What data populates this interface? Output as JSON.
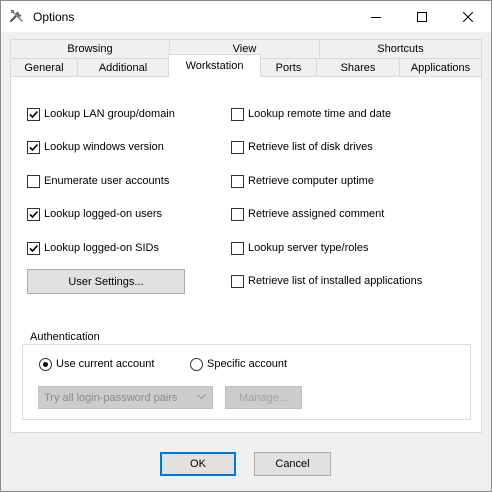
{
  "window": {
    "title": "Options"
  },
  "tabs": {
    "row1": [
      "Browsing",
      "View",
      "Shortcuts"
    ],
    "row2": [
      "General",
      "Additional",
      "Workstation",
      "Ports",
      "Shares",
      "Applications"
    ],
    "active": "Workstation"
  },
  "options_left": [
    {
      "label": "Lookup LAN group/domain",
      "checked": true
    },
    {
      "label": "Lookup windows version",
      "checked": true
    },
    {
      "label": "Enumerate user accounts",
      "checked": false
    },
    {
      "label": "Lookup logged-on users",
      "checked": true
    },
    {
      "label": "Lookup logged-on SIDs",
      "checked": true
    }
  ],
  "options_right": [
    {
      "label": "Lookup remote time and date",
      "checked": false
    },
    {
      "label": "Retrieve list of disk drives",
      "checked": false
    },
    {
      "label": "Retrieve computer uptime",
      "checked": false
    },
    {
      "label": "Retrieve assigned comment",
      "checked": false
    },
    {
      "label": "Lookup server type/roles",
      "checked": false
    },
    {
      "label": "Retrieve list of installed applications",
      "checked": false
    }
  ],
  "user_settings_button": "User Settings...",
  "authentication": {
    "legend": "Authentication",
    "use_current": "Use current account",
    "specific": "Specific account",
    "selected": "use_current",
    "select_value": "Try all login-password pairs",
    "manage_button": "Manage..."
  },
  "footer": {
    "ok": "OK",
    "cancel": "Cancel"
  },
  "colors": {
    "accent": "#0078d7",
    "check": "#000000"
  }
}
